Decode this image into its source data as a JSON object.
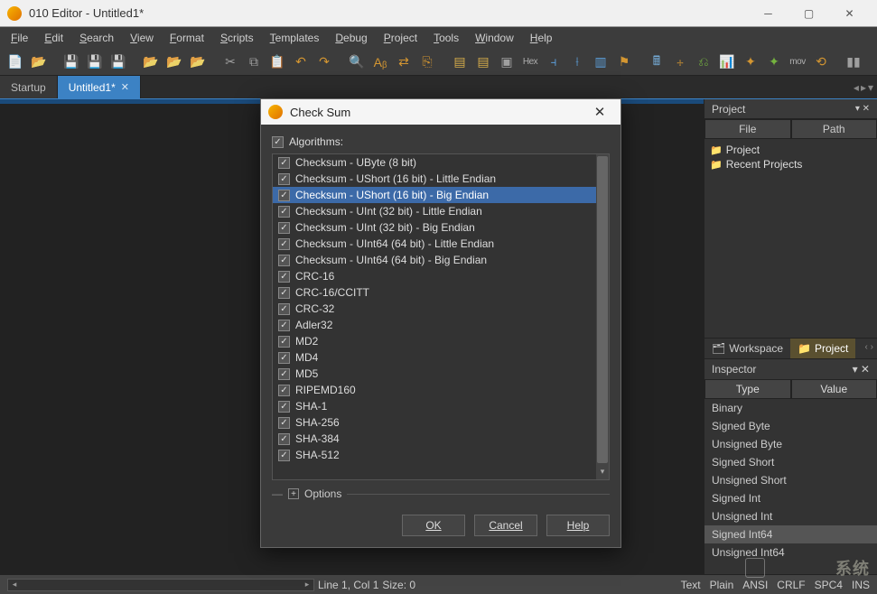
{
  "window": {
    "title": "010 Editor - Untitled1*"
  },
  "menu": [
    "File",
    "Edit",
    "Search",
    "View",
    "Format",
    "Scripts",
    "Templates",
    "Debug",
    "Project",
    "Tools",
    "Window",
    "Help"
  ],
  "tabs": {
    "items": [
      {
        "label": "Startup",
        "active": false,
        "closable": false
      },
      {
        "label": "Untitled1*",
        "active": true,
        "closable": true
      }
    ]
  },
  "project_panel": {
    "title": "Project",
    "headers": [
      "File",
      "Path"
    ],
    "tree": [
      {
        "icon": "folder",
        "label": "Project"
      },
      {
        "icon": "folder",
        "label": "Recent Projects"
      }
    ]
  },
  "workspace_tabs": {
    "items": [
      {
        "icon": "workspace",
        "label": "Workspace",
        "active": false
      },
      {
        "icon": "project",
        "label": "Project",
        "active": true
      }
    ]
  },
  "inspector": {
    "title": "Inspector",
    "headers": [
      "Type",
      "Value"
    ],
    "rows": [
      "Binary",
      "Signed Byte",
      "Unsigned Byte",
      "Signed Short",
      "Unsigned Short",
      "Signed Int",
      "Unsigned Int",
      "Signed Int64",
      "Unsigned Int64"
    ],
    "selected": "Signed Int64"
  },
  "dialog": {
    "title": "Check Sum",
    "section_label": "Algorithms:",
    "algorithms": [
      "Checksum - UByte (8 bit)",
      "Checksum - UShort (16 bit) - Little Endian",
      "Checksum - UShort (16 bit) - Big Endian",
      "Checksum - UInt (32 bit) - Little Endian",
      "Checksum - UInt (32 bit) - Big Endian",
      "Checksum - UInt64 (64 bit) - Little Endian",
      "Checksum - UInt64 (64 bit) - Big Endian",
      "CRC-16",
      "CRC-16/CCITT",
      "CRC-32",
      "Adler32",
      "MD2",
      "MD4",
      "MD5",
      "RIPEMD160",
      "SHA-1",
      "SHA-256",
      "SHA-384",
      "SHA-512"
    ],
    "selected_index": 2,
    "options_label": "Options",
    "buttons": {
      "ok": "OK",
      "cancel": "Cancel",
      "help": "Help"
    }
  },
  "statusbar": {
    "position": "Line 1, Col 1",
    "size": "Size: 0",
    "segs": [
      "Text",
      "Plain",
      "ANSI",
      "CRLF",
      "SPC4",
      "INS"
    ]
  },
  "toolbar_hex_label": "Hex",
  "toolbar_mov_label": "mov",
  "watermark": "系统"
}
